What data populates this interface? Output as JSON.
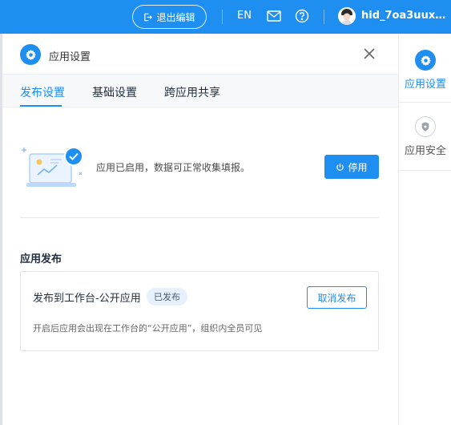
{
  "topbar": {
    "exit_label": "退出编辑",
    "lang_label": "EN",
    "username": "hid_7oa3uuxf..."
  },
  "panel": {
    "title": "应用设置",
    "tabs": [
      {
        "label": "发布设置",
        "active": true
      },
      {
        "label": "基础设置",
        "active": false
      },
      {
        "label": "跨应用共享",
        "active": false
      }
    ],
    "status_text": "应用已启用，数据可正常收集填报。",
    "stop_label": "停用",
    "section_title": "应用发布",
    "publish": {
      "title": "发布到工作台-公开应用",
      "badge": "已发布",
      "cancel_label": "取消发布",
      "desc": "开启后应用会出现在工作台的“公开应用”，组织内全员可见"
    }
  },
  "rightbar": {
    "items": [
      {
        "label": "应用设置",
        "active": true
      },
      {
        "label": "应用安全",
        "active": false
      }
    ]
  },
  "colors": {
    "primary": "#1f8ef1",
    "text": "#1f2d3d"
  }
}
